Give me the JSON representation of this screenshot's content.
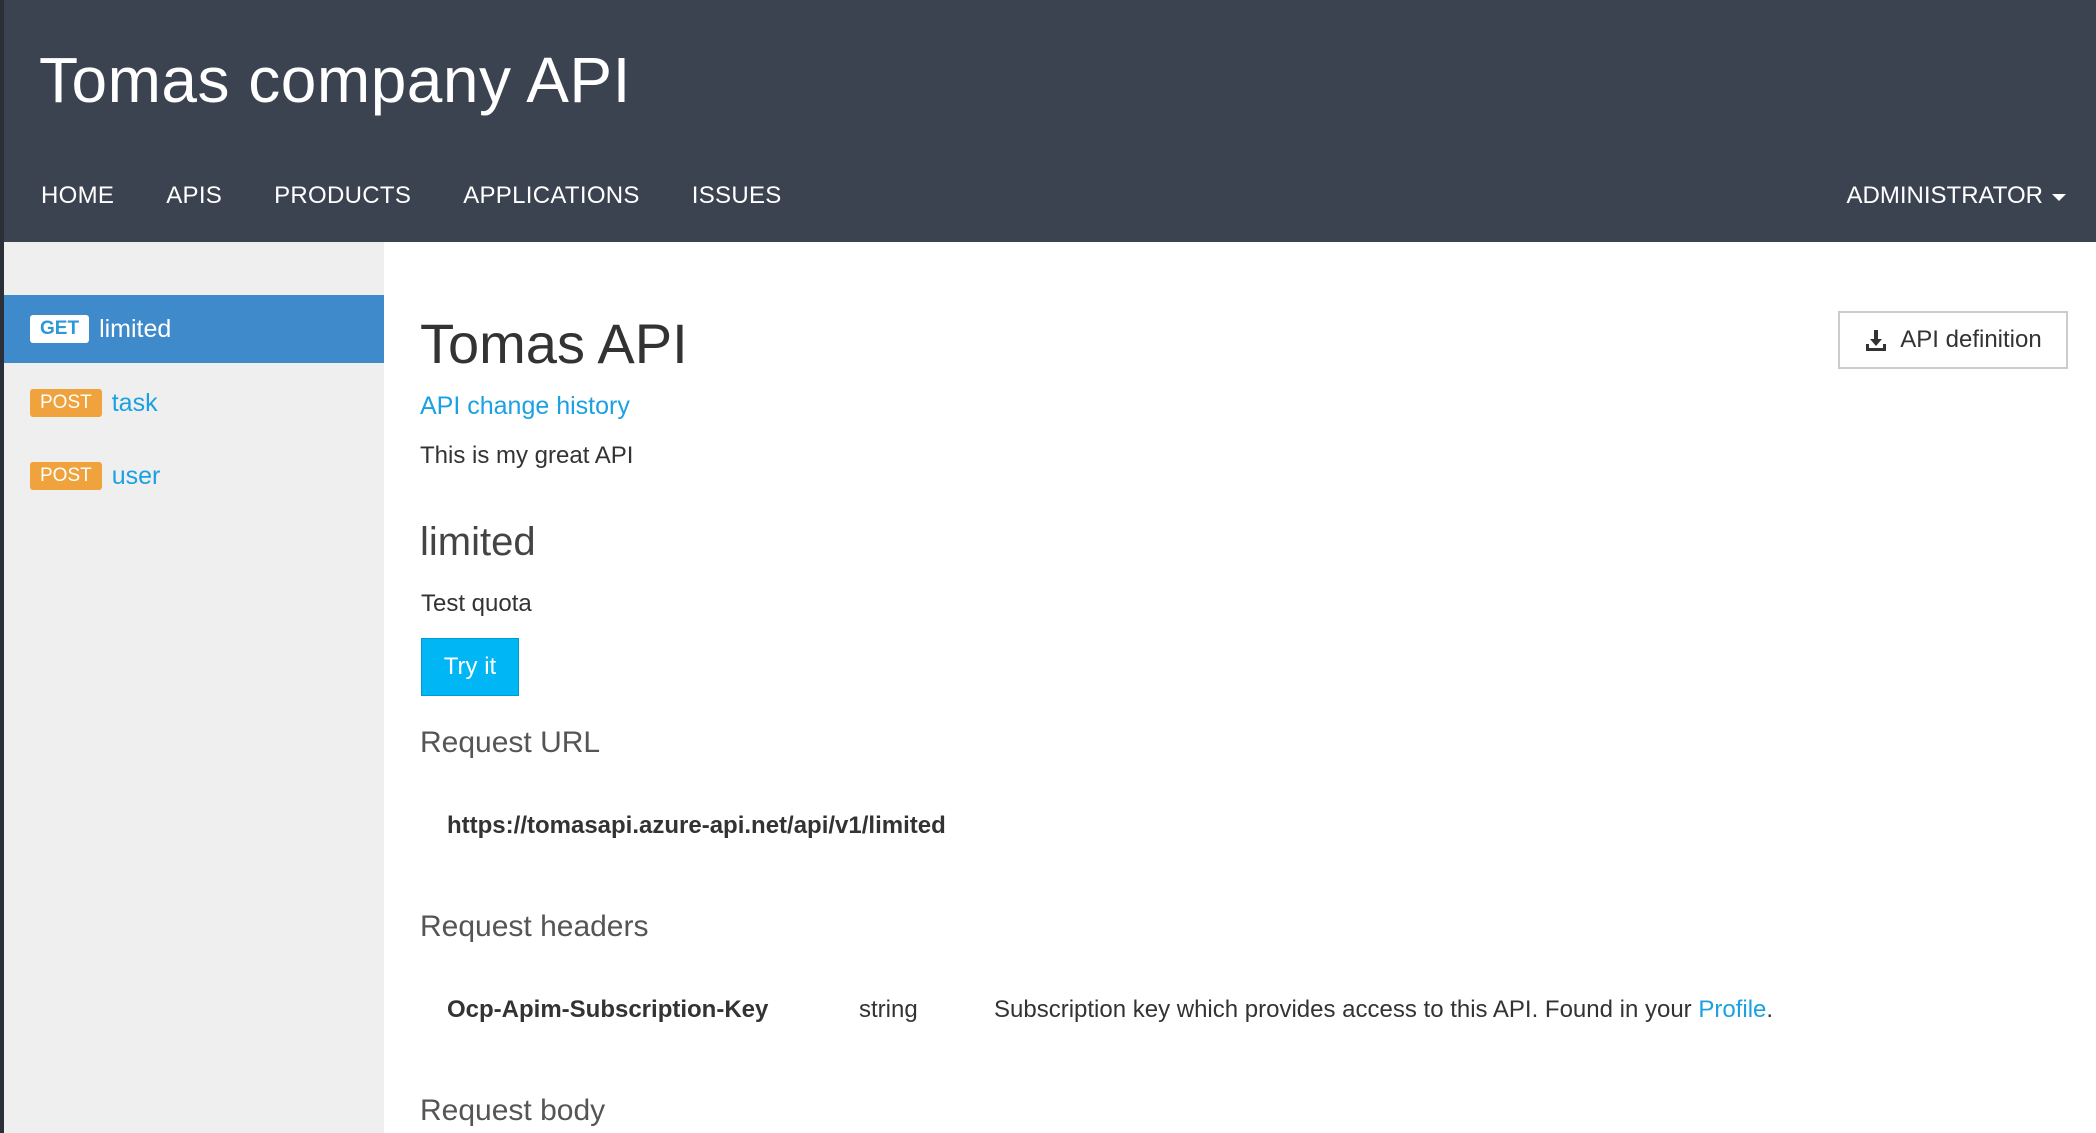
{
  "header": {
    "site_title": "Tomas company API",
    "nav": [
      {
        "label": "HOME"
      },
      {
        "label": "APIS"
      },
      {
        "label": "PRODUCTS"
      },
      {
        "label": "APPLICATIONS"
      },
      {
        "label": "ISSUES"
      }
    ],
    "user_menu": "ADMINISTRATOR"
  },
  "sidebar": {
    "operations": [
      {
        "method": "GET",
        "label": "limited",
        "active": true
      },
      {
        "method": "POST",
        "label": "task",
        "active": false
      },
      {
        "method": "POST",
        "label": "user",
        "active": false
      }
    ]
  },
  "main": {
    "api_title": "Tomas API",
    "change_history_link": "API change history",
    "api_description": "This is my great API",
    "api_definition_button": "API definition",
    "operation": {
      "name": "limited",
      "description": "Test quota",
      "try_button": "Try it"
    },
    "request_url": {
      "title": "Request URL",
      "url": "https://tomasapi.azure-api.net/api/v1/limited"
    },
    "request_headers": {
      "title": "Request headers",
      "rows": [
        {
          "name": "Ocp-Apim-Subscription-Key",
          "type": "string",
          "description": "Subscription key which provides access to this API. Found in your ",
          "link": "Profile",
          "suffix": "."
        }
      ]
    },
    "request_body": {
      "title": "Request body"
    }
  },
  "colors": {
    "header_bg": "#3c4350",
    "active_item_bg": "#3e8acb",
    "post_badge": "#f0a23d",
    "link": "#1ba1e2",
    "try_button": "#00b6f5"
  },
  "icons": {
    "api_definition": "download-icon",
    "user_menu": "caret-down-icon"
  }
}
